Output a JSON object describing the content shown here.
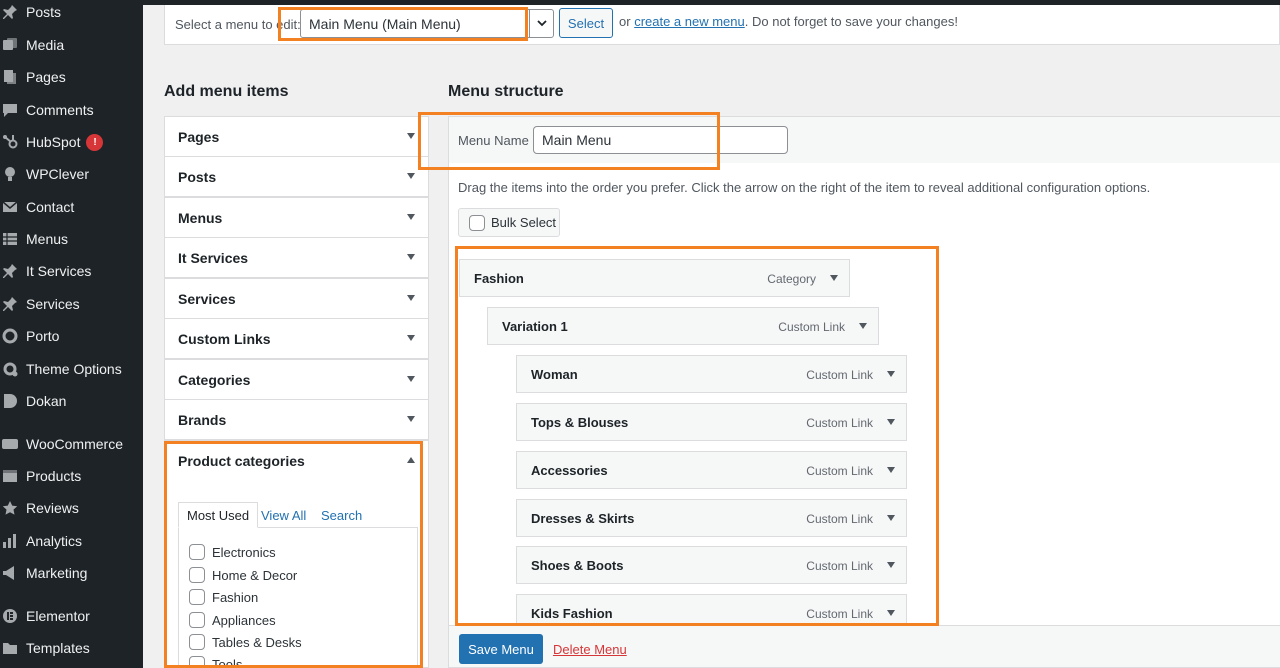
{
  "sidebar": {
    "items": [
      {
        "label": "Posts",
        "icon": "pin-icon"
      },
      {
        "label": "Media",
        "icon": "media-icon"
      },
      {
        "label": "Pages",
        "icon": "pages-icon"
      },
      {
        "label": "Comments",
        "icon": "comment-icon"
      },
      {
        "label": "HubSpot",
        "icon": "hubspot-icon",
        "badge": "!"
      },
      {
        "label": "WPClever",
        "icon": "bulb-icon"
      },
      {
        "label": "Contact",
        "icon": "mail-icon"
      },
      {
        "label": "Menus",
        "icon": "grid-icon"
      },
      {
        "label": "It Services",
        "icon": "pin-icon"
      },
      {
        "label": "Services",
        "icon": "pin-icon"
      },
      {
        "label": "Porto",
        "icon": "circle-icon"
      },
      {
        "label": "Theme Options",
        "icon": "gear-icon"
      },
      {
        "label": "Dokan",
        "icon": "dokan-icon"
      },
      {
        "label": "WooCommerce",
        "icon": "woo-icon"
      },
      {
        "label": "Products",
        "icon": "box-icon"
      },
      {
        "label": "Reviews",
        "icon": "star-icon"
      },
      {
        "label": "Analytics",
        "icon": "bar-chart-icon"
      },
      {
        "label": "Marketing",
        "icon": "megaphone-icon"
      },
      {
        "label": "Elementor",
        "icon": "elementor-icon"
      },
      {
        "label": "Templates",
        "icon": "folder-icon"
      }
    ]
  },
  "select_bar": {
    "label": "Select a menu to edit:",
    "selected_menu": "Main Menu (Main Menu)",
    "select_button": "Select",
    "or_text": "or",
    "create_link": "create a new menu",
    "reminder": ". Do not forget to save your changes!"
  },
  "add_items": {
    "title": "Add menu items",
    "sections": [
      "Pages",
      "Posts",
      "Menus",
      "It Services",
      "Services",
      "Custom Links",
      "Categories",
      "Brands",
      "Product categories"
    ],
    "tabs": [
      "Most Used",
      "View All",
      "Search"
    ],
    "categories": [
      "Electronics",
      "Home & Decor",
      "Fashion",
      "Appliances",
      "Tables & Desks",
      "Tools"
    ]
  },
  "structure": {
    "title": "Menu structure",
    "menu_name_label": "Menu Name",
    "menu_name_value": "Main Menu",
    "instructions": "Drag the items into the order you prefer. Click the arrow on the right of the item to reveal additional configuration options.",
    "bulk_select": "Bulk Select",
    "items": [
      {
        "title": "Fashion",
        "type": "Category",
        "depth": 0
      },
      {
        "title": "Variation 1",
        "type": "Custom Link",
        "depth": 1
      },
      {
        "title": "Woman",
        "type": "Custom Link",
        "depth": 2
      },
      {
        "title": "Tops & Blouses",
        "type": "Custom Link",
        "depth": 2
      },
      {
        "title": "Accessories",
        "type": "Custom Link",
        "depth": 2
      },
      {
        "title": "Dresses & Skirts",
        "type": "Custom Link",
        "depth": 2
      },
      {
        "title": "Shoes & Boots",
        "type": "Custom Link",
        "depth": 2
      },
      {
        "title": "Kids Fashion",
        "type": "Custom Link",
        "depth": 2
      }
    ],
    "save_button": "Save Menu",
    "delete_link": "Delete Menu"
  },
  "colors": {
    "sidebar_bg": "#1d2327",
    "accent": "#2271b1",
    "highlight": "#f38121",
    "danger": "#d63638"
  }
}
